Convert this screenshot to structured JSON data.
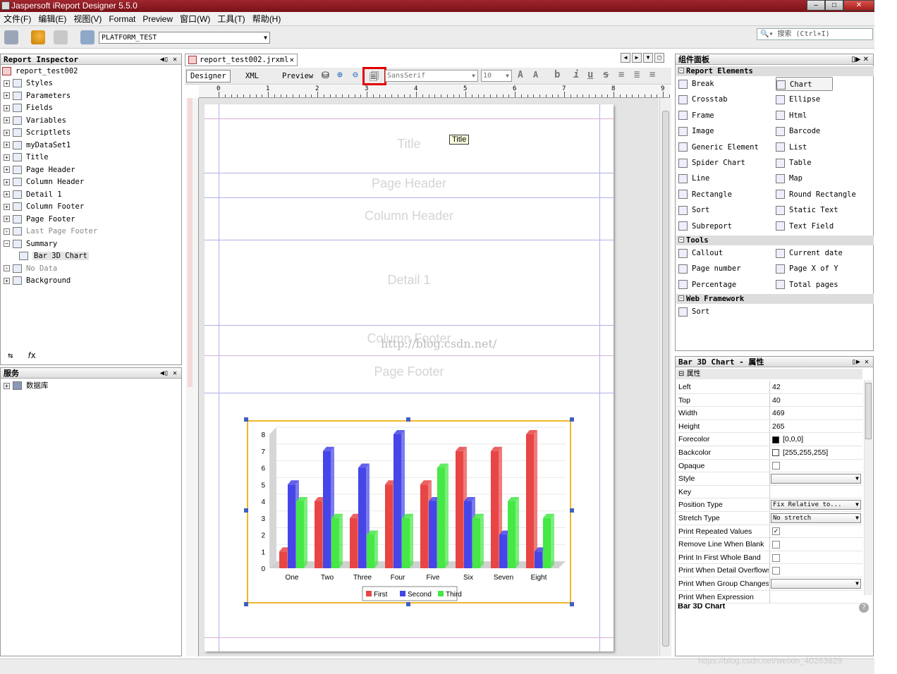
{
  "app": {
    "title": "Jaspersoft iReport Designer 5.5.0"
  },
  "menu": [
    "文件(F)",
    "编辑(E)",
    "视图(V)",
    "Format",
    "Preview",
    "窗口(W)",
    "工具(T)",
    "帮助(H)"
  ],
  "toolbar": {
    "datasource": "PLATFORM_TEST",
    "search_placeholder": "搜索 (Ctrl+I)"
  },
  "inspector": {
    "title": "Report Inspector",
    "root": "report_test002",
    "items": [
      "Styles",
      "Parameters",
      "Fields",
      "Variables",
      "Scriptlets",
      "myDataSet1",
      "Title",
      "Page Header",
      "Column Header",
      "Detail 1",
      "Column Footer",
      "Page Footer",
      "Last Page Footer",
      "Summary",
      "Bar 3D Chart",
      "No Data",
      "Background"
    ]
  },
  "services": {
    "title": "服务",
    "db": "数据库"
  },
  "editor": {
    "tab": "report_test002.jrxml",
    "views": [
      "Designer",
      "XML",
      "Preview"
    ],
    "font": "SansSerif",
    "size": "10",
    "ruler": [
      "0",
      "1",
      "2",
      "3",
      "4",
      "5",
      "6",
      "7",
      "8",
      "9"
    ],
    "bands": [
      "Title",
      "Page Header",
      "Column Header",
      "Detail 1",
      "Column Footer",
      "Page Footer"
    ],
    "tooltip": "Title",
    "watermark": "http://blog.csdn.net/"
  },
  "chart_data": {
    "type": "bar",
    "categories": [
      "One",
      "Two",
      "Three",
      "Four",
      "Five",
      "Six",
      "Seven",
      "Eight"
    ],
    "series": [
      {
        "name": "First",
        "values": [
          1,
          4,
          3,
          5,
          5,
          7,
          7,
          8
        ]
      },
      {
        "name": "Second",
        "values": [
          5,
          7,
          6,
          8,
          4,
          4,
          2,
          1
        ]
      },
      {
        "name": "Third",
        "values": [
          4,
          3,
          2,
          3,
          6,
          3,
          4,
          3
        ]
      }
    ],
    "ylim": [
      0,
      8
    ],
    "yticks": [
      "0",
      "1",
      "2",
      "3",
      "4",
      "5",
      "6",
      "7",
      "8"
    ],
    "colors": [
      "#e84545",
      "#4545e8",
      "#45e845"
    ],
    "legend": "bottom"
  },
  "palette": {
    "title": "组件面板",
    "categories": [
      {
        "name": "Report Elements",
        "items": [
          "Break",
          "Chart",
          "Crosstab",
          "Ellipse",
          "Frame",
          "Html",
          "Image",
          "Barcode",
          "Generic Element",
          "List",
          "Spider Chart",
          "Table",
          "Line",
          "Map",
          "Rectangle",
          "Round Rectangle",
          "Sort",
          "Static Text",
          "Subreport",
          "Text Field"
        ]
      },
      {
        "name": "Tools",
        "items": [
          "Callout",
          "Current date",
          "Page number",
          "Page X of Y",
          "Percentage",
          "Total pages"
        ]
      },
      {
        "name": "Web Framework",
        "items": [
          "Sort"
        ]
      }
    ]
  },
  "properties": {
    "title": "Bar 3D Chart - 属性",
    "section": "属性",
    "rows": [
      {
        "name": "Left",
        "value": "42"
      },
      {
        "name": "Top",
        "value": "40"
      },
      {
        "name": "Width",
        "value": "469"
      },
      {
        "name": "Height",
        "value": "265"
      },
      {
        "name": "Forecolor",
        "value": "[0,0,0]"
      },
      {
        "name": "Backcolor",
        "value": "[255,255,255]"
      },
      {
        "name": "Opaque",
        "value": ""
      },
      {
        "name": "Style",
        "value": ""
      },
      {
        "name": "Key",
        "value": ""
      },
      {
        "name": "Position Type",
        "value": "Fix Relative to..."
      },
      {
        "name": "Stretch Type",
        "value": "No stretch"
      },
      {
        "name": "Print Repeated Values",
        "value": ""
      },
      {
        "name": "Remove Line When Blank",
        "value": ""
      },
      {
        "name": "Print In First Whole Band",
        "value": ""
      },
      {
        "name": "Print When Detail Overflows",
        "value": ""
      },
      {
        "name": "Print When Group Changes",
        "value": ""
      },
      {
        "name": "Print When Expression",
        "value": ""
      }
    ],
    "footer": "Bar 3D Chart"
  },
  "status": {
    "watermark": "https://blog.csdn.net/weixin_40263829"
  }
}
